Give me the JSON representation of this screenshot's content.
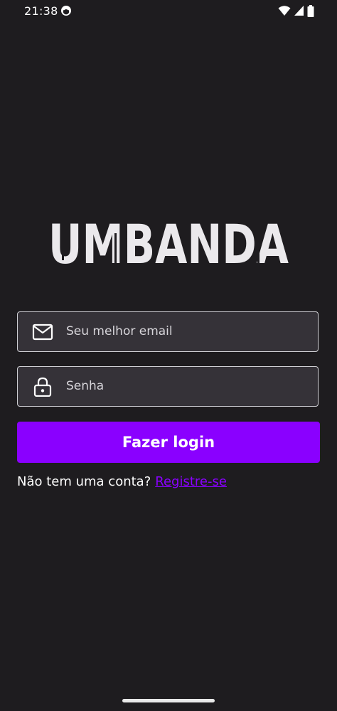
{
  "status_bar": {
    "time": "21:38",
    "icons": [
      "app-notification-icon",
      "wifi-icon",
      "cell-signal-icon",
      "battery-icon"
    ]
  },
  "logo": {
    "text": "UMBANDA"
  },
  "email_field": {
    "placeholder": "Seu melhor email",
    "value": "",
    "icon": "mail-icon"
  },
  "password_field": {
    "placeholder": "Senha",
    "value": "",
    "icon": "lock-icon"
  },
  "login_button": {
    "label": "Fazer login"
  },
  "register": {
    "prompt": "Não tem uma conta?",
    "link_label": "Registre-se"
  },
  "colors": {
    "background": "#1e1c1f",
    "accent": "#8a00ff",
    "field_background": "#353238",
    "field_border": "#cfcfd4"
  }
}
